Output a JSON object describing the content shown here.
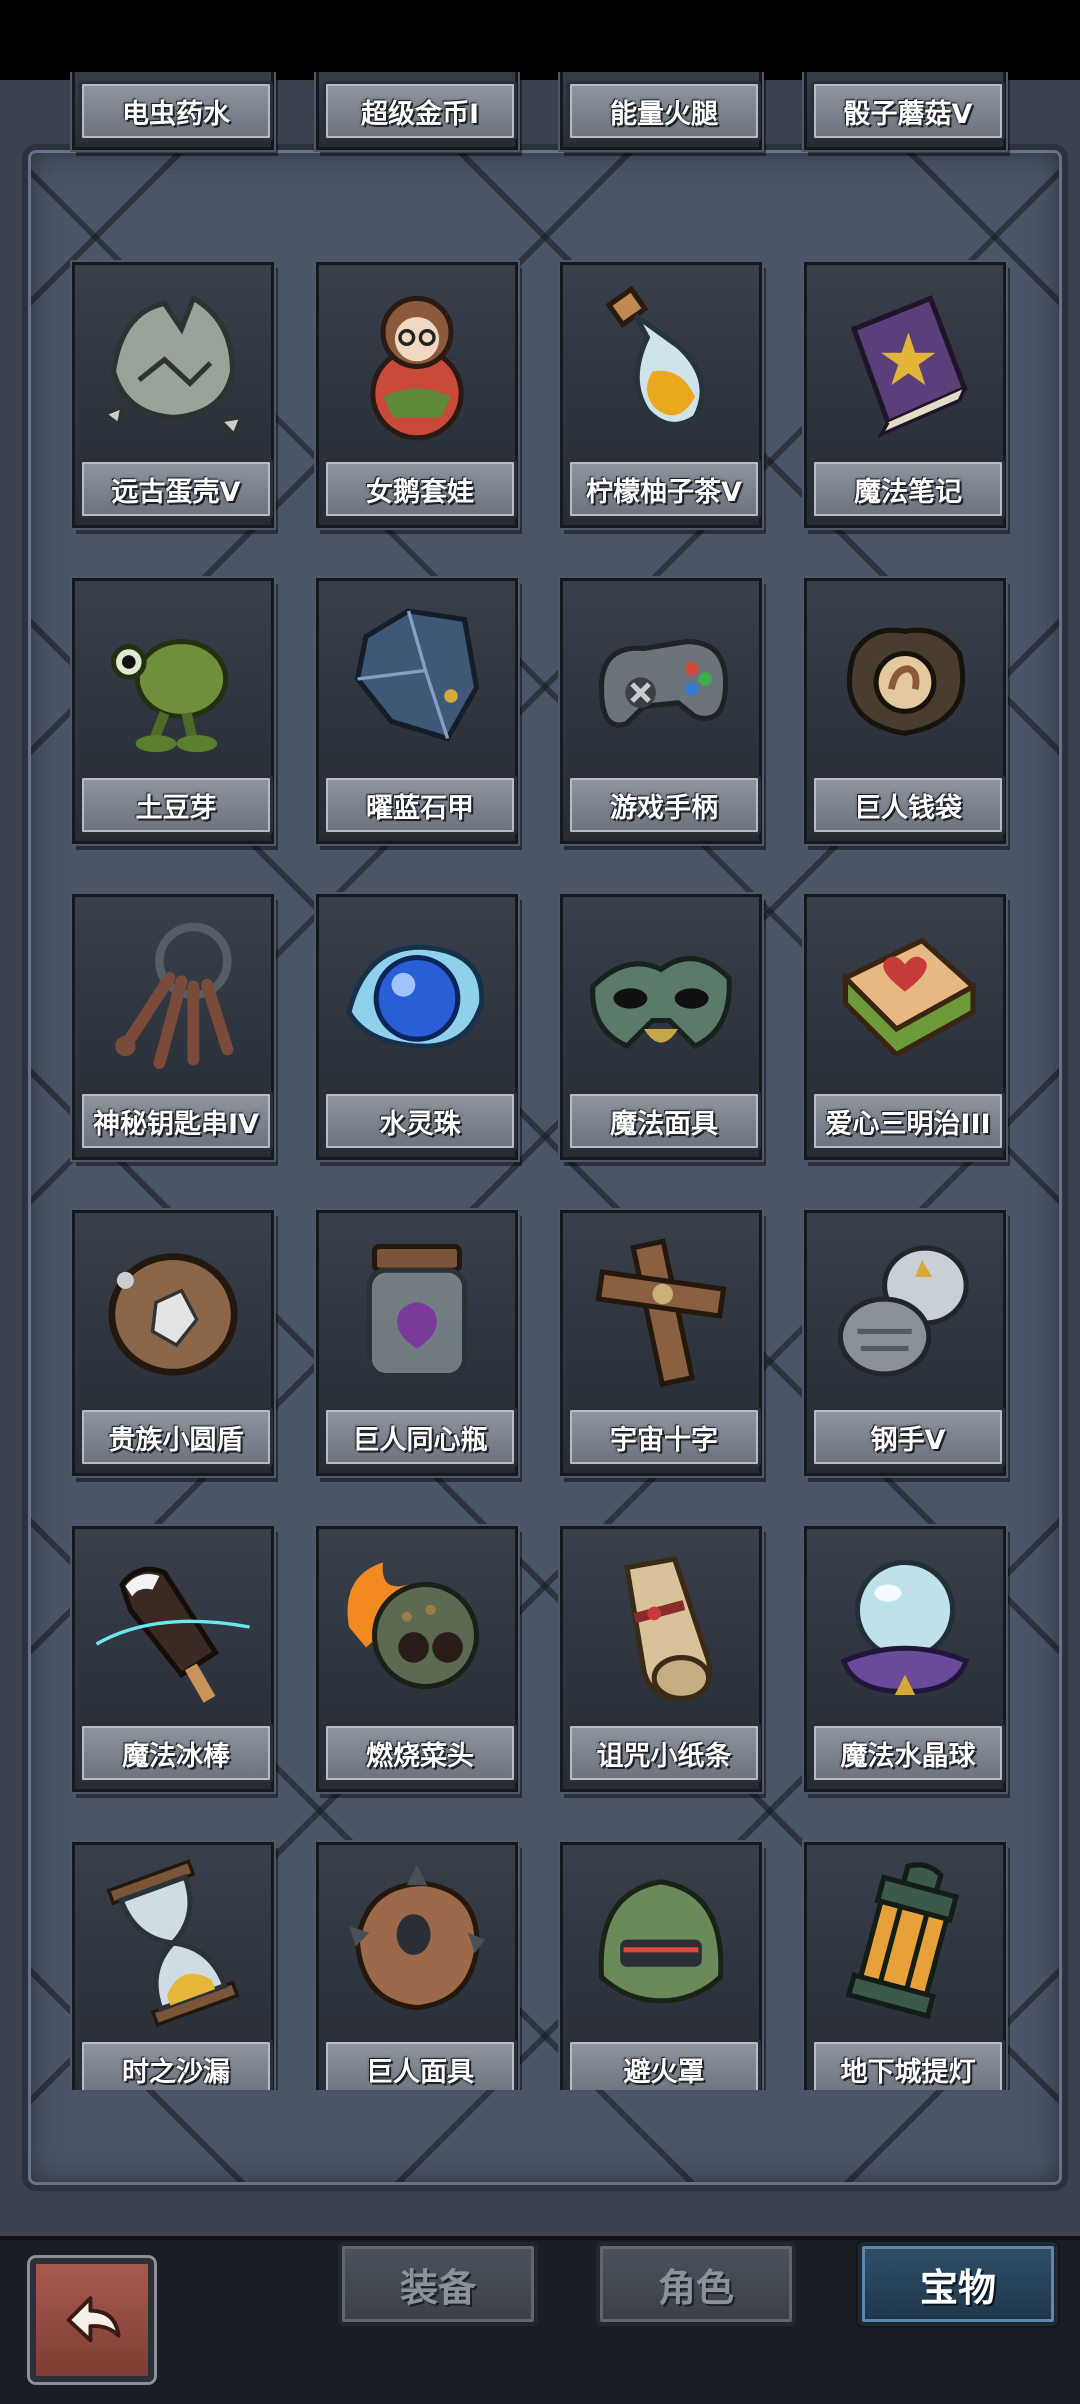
{
  "tabs": {
    "equipment": "装备",
    "characters": "角色",
    "treasures": "宝物",
    "active": "treasures"
  },
  "top_row": [
    {
      "name": "电虫药水"
    },
    {
      "name": "超级金币I"
    },
    {
      "name": "能量火腿"
    },
    {
      "name": "骰子蘑菇V"
    }
  ],
  "items": [
    {
      "name": "远古蛋壳V",
      "icon": "eggshell-icon"
    },
    {
      "name": "女鹅套娃",
      "icon": "nesting-doll-icon"
    },
    {
      "name": "柠檬柚子茶V",
      "icon": "tea-bottle-icon"
    },
    {
      "name": "魔法笔记",
      "icon": "magic-book-icon"
    },
    {
      "name": "土豆芽",
      "icon": "peashooter-sprout-icon"
    },
    {
      "name": "曜蓝石甲",
      "icon": "blue-armor-icon"
    },
    {
      "name": "游戏手柄",
      "icon": "gamepad-icon"
    },
    {
      "name": "巨人钱袋",
      "icon": "money-bag-icon"
    },
    {
      "name": "神秘钥匙串IV",
      "icon": "keychain-icon"
    },
    {
      "name": "水灵珠",
      "icon": "water-orb-icon"
    },
    {
      "name": "魔法面具",
      "icon": "magic-mask-icon"
    },
    {
      "name": "爱心三明治III",
      "icon": "heart-sandwich-icon"
    },
    {
      "name": "贵族小圆盾",
      "icon": "round-shield-icon"
    },
    {
      "name": "巨人同心瓶",
      "icon": "jar-icon"
    },
    {
      "name": "宇宙十字",
      "icon": "wooden-cross-icon"
    },
    {
      "name": "钢手V",
      "icon": "steel-gauntlet-icon"
    },
    {
      "name": "魔法冰棒",
      "icon": "ice-pop-icon"
    },
    {
      "name": "燃烧菜头",
      "icon": "burning-bomb-icon"
    },
    {
      "name": "诅咒小纸条",
      "icon": "scroll-icon"
    },
    {
      "name": "魔法水晶球",
      "icon": "crystal-ball-icon"
    },
    {
      "name": "时之沙漏",
      "icon": "hourglass-icon"
    },
    {
      "name": "巨人面具",
      "icon": "spiked-mask-icon"
    },
    {
      "name": "避火罩",
      "icon": "fire-helmet-icon"
    },
    {
      "name": "地下城提灯",
      "icon": "lantern-icon"
    }
  ],
  "back_icon": "back-arrow-icon"
}
